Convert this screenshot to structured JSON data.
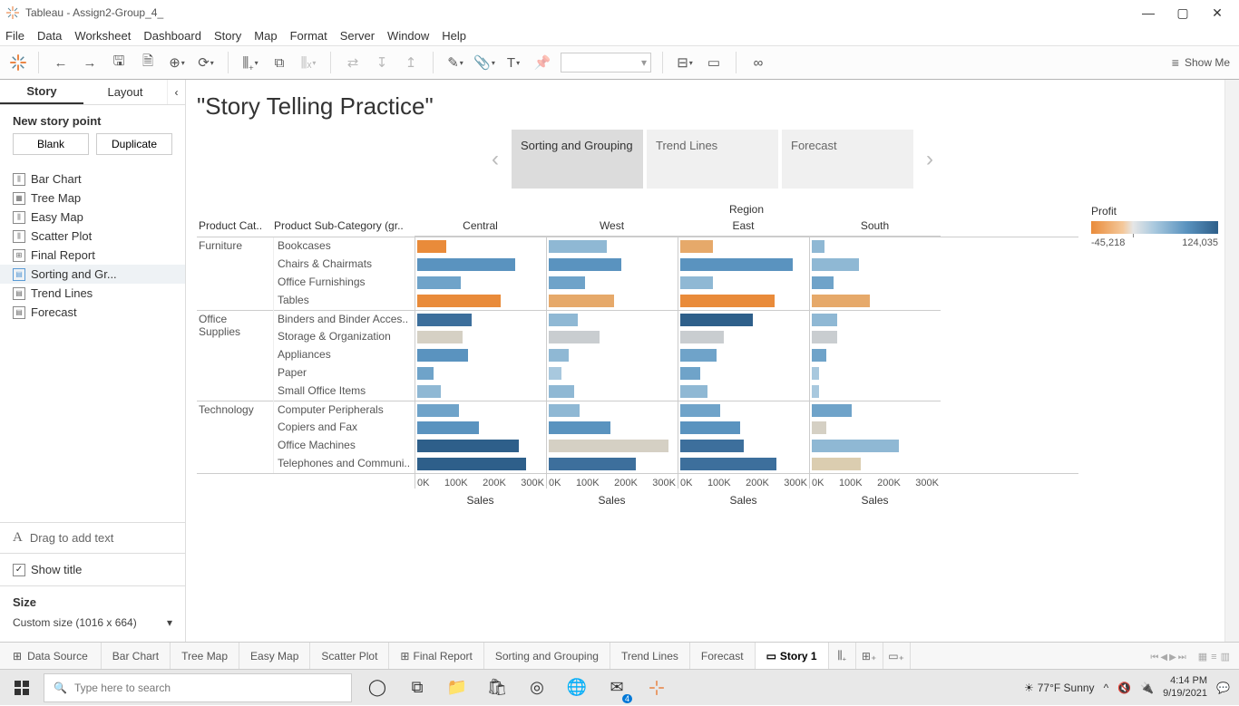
{
  "titlebar": {
    "app": "Tableau",
    "file": "Assign2-Group_4_"
  },
  "menu": [
    "File",
    "Data",
    "Worksheet",
    "Dashboard",
    "Story",
    "Map",
    "Format",
    "Server",
    "Window",
    "Help"
  ],
  "showme": "Show Me",
  "sidebar": {
    "tabs": [
      "Story",
      "Layout"
    ],
    "new_point": "New story point",
    "blank": "Blank",
    "duplicate": "Duplicate",
    "sheets": [
      {
        "label": "Bar Chart",
        "icon": "⫼"
      },
      {
        "label": "Tree Map",
        "icon": "▦"
      },
      {
        "label": "Easy Map",
        "icon": "⫼"
      },
      {
        "label": "Scatter Plot",
        "icon": "⫼"
      },
      {
        "label": "Final Report",
        "icon": "⊞"
      },
      {
        "label": "Sorting and Gr...",
        "icon": "▤",
        "selected": true
      },
      {
        "label": "Trend Lines",
        "icon": "▤"
      },
      {
        "label": "Forecast",
        "icon": "▤"
      }
    ],
    "drag_text": "Drag to add text",
    "show_title": "Show title",
    "size_hd": "Size",
    "size_value": "Custom size (1016 x 664)"
  },
  "story": {
    "title": "\"Story Telling Practice\"",
    "points": [
      {
        "label": "Sorting and Grouping",
        "active": true
      },
      {
        "label": "Trend Lines"
      },
      {
        "label": "Forecast"
      }
    ]
  },
  "legend": {
    "title": "Profit",
    "min": "-45,218",
    "max": "124,035"
  },
  "chart_data": {
    "type": "bar",
    "region_title": "Region",
    "cat_header": "Product Cat..",
    "sub_header": "Product Sub-Category (gr..",
    "x_title": "Sales",
    "ticks": [
      "0K",
      "100K",
      "200K",
      "300K"
    ],
    "xmax": 350000,
    "regions": [
      "Central",
      "West",
      "East",
      "South"
    ],
    "categories": [
      {
        "name": "Furniture",
        "subs": [
          {
            "name": "Bookcases",
            "vals": [
              {
                "v": 80000,
                "c": "#e98b3a"
              },
              {
                "v": 160000,
                "c": "#8fb8d4"
              },
              {
                "v": 90000,
                "c": "#e6a96a"
              },
              {
                "v": 35000,
                "c": "#8fb8d4"
              }
            ]
          },
          {
            "name": "Chairs & Chairmats",
            "vals": [
              {
                "v": 270000,
                "c": "#5a93bf"
              },
              {
                "v": 200000,
                "c": "#5a93bf"
              },
              {
                "v": 310000,
                "c": "#5a93bf"
              },
              {
                "v": 130000,
                "c": "#8fb8d4"
              }
            ]
          },
          {
            "name": "Office Furnishings",
            "vals": [
              {
                "v": 120000,
                "c": "#6fa3c9"
              },
              {
                "v": 100000,
                "c": "#6fa3c9"
              },
              {
                "v": 90000,
                "c": "#8fb8d4"
              },
              {
                "v": 60000,
                "c": "#6fa3c9"
              }
            ]
          },
          {
            "name": "Tables",
            "vals": [
              {
                "v": 230000,
                "c": "#e98b3a"
              },
              {
                "v": 180000,
                "c": "#e6a96a"
              },
              {
                "v": 260000,
                "c": "#e98b3a"
              },
              {
                "v": 160000,
                "c": "#e6a96a"
              }
            ]
          }
        ]
      },
      {
        "name": "Office Supplies",
        "subs": [
          {
            "name": "Binders and Binder Acces..",
            "vals": [
              {
                "v": 150000,
                "c": "#3d6f9c"
              },
              {
                "v": 80000,
                "c": "#8fb8d4"
              },
              {
                "v": 200000,
                "c": "#2e5f8a"
              },
              {
                "v": 70000,
                "c": "#8fb8d4"
              }
            ]
          },
          {
            "name": "Storage & Organization",
            "vals": [
              {
                "v": 125000,
                "c": "#d5d0c4"
              },
              {
                "v": 140000,
                "c": "#c9cdd0"
              },
              {
                "v": 120000,
                "c": "#c9cdd0"
              },
              {
                "v": 70000,
                "c": "#c9cdd0"
              }
            ]
          },
          {
            "name": "Appliances",
            "vals": [
              {
                "v": 140000,
                "c": "#5a93bf"
              },
              {
                "v": 55000,
                "c": "#8fb8d4"
              },
              {
                "v": 100000,
                "c": "#6fa3c9"
              },
              {
                "v": 40000,
                "c": "#6fa3c9"
              }
            ]
          },
          {
            "name": "Paper",
            "vals": [
              {
                "v": 45000,
                "c": "#6fa3c9"
              },
              {
                "v": 35000,
                "c": "#a8c8de"
              },
              {
                "v": 55000,
                "c": "#6fa3c9"
              },
              {
                "v": 20000,
                "c": "#a8c8de"
              }
            ]
          },
          {
            "name": "Small Office Items",
            "vals": [
              {
                "v": 65000,
                "c": "#8fb8d4"
              },
              {
                "v": 70000,
                "c": "#8fb8d4"
              },
              {
                "v": 75000,
                "c": "#8fb8d4"
              },
              {
                "v": 20000,
                "c": "#a8c8de"
              }
            ]
          }
        ]
      },
      {
        "name": "Technology",
        "subs": [
          {
            "name": "Computer Peripherals",
            "vals": [
              {
                "v": 115000,
                "c": "#6fa3c9"
              },
              {
                "v": 85000,
                "c": "#8fb8d4"
              },
              {
                "v": 110000,
                "c": "#6fa3c9"
              },
              {
                "v": 110000,
                "c": "#6fa3c9"
              }
            ]
          },
          {
            "name": "Copiers and Fax",
            "vals": [
              {
                "v": 170000,
                "c": "#5a93bf"
              },
              {
                "v": 170000,
                "c": "#5a93bf"
              },
              {
                "v": 165000,
                "c": "#5a93bf"
              },
              {
                "v": 40000,
                "c": "#d5d0c4"
              }
            ]
          },
          {
            "name": "Office Machines",
            "vals": [
              {
                "v": 280000,
                "c": "#2e5f8a"
              },
              {
                "v": 330000,
                "c": "#d5d0c4"
              },
              {
                "v": 175000,
                "c": "#3d6f9c"
              },
              {
                "v": 240000,
                "c": "#8fb8d4"
              }
            ]
          },
          {
            "name": "Telephones and Communi..",
            "vals": [
              {
                "v": 300000,
                "c": "#2e5f8a"
              },
              {
                "v": 240000,
                "c": "#3d6f9c"
              },
              {
                "v": 265000,
                "c": "#3d6f9c"
              },
              {
                "v": 135000,
                "c": "#dbcdb0"
              }
            ]
          }
        ]
      }
    ]
  },
  "bottom_tabs": {
    "data_source": "Data Source",
    "tabs": [
      "Bar Chart",
      "Tree Map",
      "Easy Map",
      "Scatter Plot",
      "Final Report",
      "Sorting and Grouping",
      "Trend Lines",
      "Forecast"
    ],
    "active": "Story 1"
  },
  "taskbar": {
    "search_placeholder": "Type here to search",
    "weather": "77°F  Sunny",
    "time": "4:14 PM",
    "date": "9/19/2021",
    "mail_badge": "4"
  }
}
